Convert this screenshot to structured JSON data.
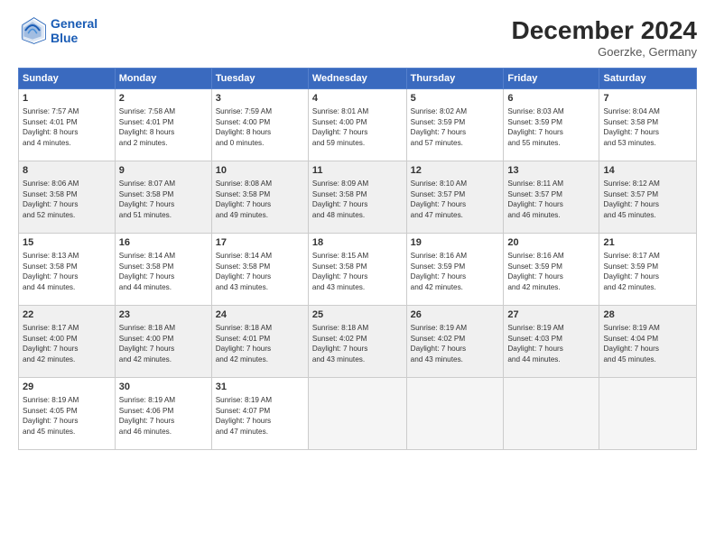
{
  "header": {
    "logo_line1": "General",
    "logo_line2": "Blue",
    "month": "December 2024",
    "location": "Goerzke, Germany"
  },
  "days_of_week": [
    "Sunday",
    "Monday",
    "Tuesday",
    "Wednesday",
    "Thursday",
    "Friday",
    "Saturday"
  ],
  "weeks": [
    [
      {
        "day": 1,
        "info": "Sunrise: 7:57 AM\nSunset: 4:01 PM\nDaylight: 8 hours\nand 4 minutes."
      },
      {
        "day": 2,
        "info": "Sunrise: 7:58 AM\nSunset: 4:01 PM\nDaylight: 8 hours\nand 2 minutes."
      },
      {
        "day": 3,
        "info": "Sunrise: 7:59 AM\nSunset: 4:00 PM\nDaylight: 8 hours\nand 0 minutes."
      },
      {
        "day": 4,
        "info": "Sunrise: 8:01 AM\nSunset: 4:00 PM\nDaylight: 7 hours\nand 59 minutes."
      },
      {
        "day": 5,
        "info": "Sunrise: 8:02 AM\nSunset: 3:59 PM\nDaylight: 7 hours\nand 57 minutes."
      },
      {
        "day": 6,
        "info": "Sunrise: 8:03 AM\nSunset: 3:59 PM\nDaylight: 7 hours\nand 55 minutes."
      },
      {
        "day": 7,
        "info": "Sunrise: 8:04 AM\nSunset: 3:58 PM\nDaylight: 7 hours\nand 53 minutes."
      }
    ],
    [
      {
        "day": 8,
        "info": "Sunrise: 8:06 AM\nSunset: 3:58 PM\nDaylight: 7 hours\nand 52 minutes."
      },
      {
        "day": 9,
        "info": "Sunrise: 8:07 AM\nSunset: 3:58 PM\nDaylight: 7 hours\nand 51 minutes."
      },
      {
        "day": 10,
        "info": "Sunrise: 8:08 AM\nSunset: 3:58 PM\nDaylight: 7 hours\nand 49 minutes."
      },
      {
        "day": 11,
        "info": "Sunrise: 8:09 AM\nSunset: 3:58 PM\nDaylight: 7 hours\nand 48 minutes."
      },
      {
        "day": 12,
        "info": "Sunrise: 8:10 AM\nSunset: 3:57 PM\nDaylight: 7 hours\nand 47 minutes."
      },
      {
        "day": 13,
        "info": "Sunrise: 8:11 AM\nSunset: 3:57 PM\nDaylight: 7 hours\nand 46 minutes."
      },
      {
        "day": 14,
        "info": "Sunrise: 8:12 AM\nSunset: 3:57 PM\nDaylight: 7 hours\nand 45 minutes."
      }
    ],
    [
      {
        "day": 15,
        "info": "Sunrise: 8:13 AM\nSunset: 3:58 PM\nDaylight: 7 hours\nand 44 minutes."
      },
      {
        "day": 16,
        "info": "Sunrise: 8:14 AM\nSunset: 3:58 PM\nDaylight: 7 hours\nand 44 minutes."
      },
      {
        "day": 17,
        "info": "Sunrise: 8:14 AM\nSunset: 3:58 PM\nDaylight: 7 hours\nand 43 minutes."
      },
      {
        "day": 18,
        "info": "Sunrise: 8:15 AM\nSunset: 3:58 PM\nDaylight: 7 hours\nand 43 minutes."
      },
      {
        "day": 19,
        "info": "Sunrise: 8:16 AM\nSunset: 3:59 PM\nDaylight: 7 hours\nand 42 minutes."
      },
      {
        "day": 20,
        "info": "Sunrise: 8:16 AM\nSunset: 3:59 PM\nDaylight: 7 hours\nand 42 minutes."
      },
      {
        "day": 21,
        "info": "Sunrise: 8:17 AM\nSunset: 3:59 PM\nDaylight: 7 hours\nand 42 minutes."
      }
    ],
    [
      {
        "day": 22,
        "info": "Sunrise: 8:17 AM\nSunset: 4:00 PM\nDaylight: 7 hours\nand 42 minutes."
      },
      {
        "day": 23,
        "info": "Sunrise: 8:18 AM\nSunset: 4:00 PM\nDaylight: 7 hours\nand 42 minutes."
      },
      {
        "day": 24,
        "info": "Sunrise: 8:18 AM\nSunset: 4:01 PM\nDaylight: 7 hours\nand 42 minutes."
      },
      {
        "day": 25,
        "info": "Sunrise: 8:18 AM\nSunset: 4:02 PM\nDaylight: 7 hours\nand 43 minutes."
      },
      {
        "day": 26,
        "info": "Sunrise: 8:19 AM\nSunset: 4:02 PM\nDaylight: 7 hours\nand 43 minutes."
      },
      {
        "day": 27,
        "info": "Sunrise: 8:19 AM\nSunset: 4:03 PM\nDaylight: 7 hours\nand 44 minutes."
      },
      {
        "day": 28,
        "info": "Sunrise: 8:19 AM\nSunset: 4:04 PM\nDaylight: 7 hours\nand 45 minutes."
      }
    ],
    [
      {
        "day": 29,
        "info": "Sunrise: 8:19 AM\nSunset: 4:05 PM\nDaylight: 7 hours\nand 45 minutes."
      },
      {
        "day": 30,
        "info": "Sunrise: 8:19 AM\nSunset: 4:06 PM\nDaylight: 7 hours\nand 46 minutes."
      },
      {
        "day": 31,
        "info": "Sunrise: 8:19 AM\nSunset: 4:07 PM\nDaylight: 7 hours\nand 47 minutes."
      },
      null,
      null,
      null,
      null
    ]
  ]
}
